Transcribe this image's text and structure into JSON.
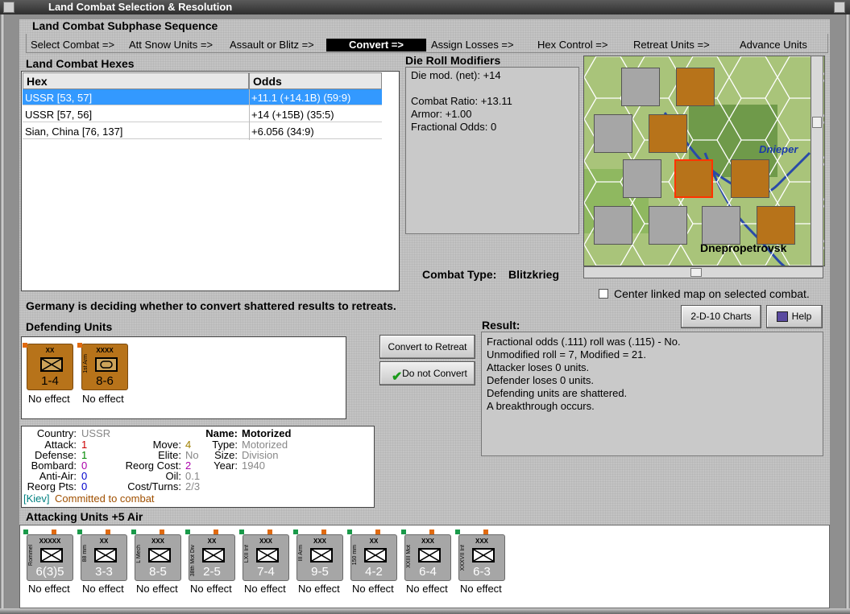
{
  "window": {
    "title": "Land Combat Selection & Resolution"
  },
  "sequence": {
    "title": "Land Combat Subphase Sequence",
    "steps": [
      {
        "label": "Select Combat =>"
      },
      {
        "label": "Att Snow Units =>"
      },
      {
        "label": "Assault or Blitz =>"
      },
      {
        "label": "Convert =>"
      },
      {
        "label": "Assign Losses =>"
      },
      {
        "label": "Hex Control =>"
      },
      {
        "label": "Retreat Units =>"
      },
      {
        "label": "Advance Units"
      }
    ],
    "active_index": 3
  },
  "hexes": {
    "title": "Land Combat Hexes",
    "columns": [
      "Hex",
      "Odds"
    ],
    "rows": [
      {
        "hex": "USSR [53, 57]",
        "odds": "+11.1 (+14.1B) (59:9)",
        "selected": true
      },
      {
        "hex": "USSR [57, 56]",
        "odds": "+14 (+15B) (35:5)",
        "selected": false
      },
      {
        "hex": "Sian, China [76, 137]",
        "odds": "+6.056 (34:9)",
        "selected": false
      }
    ]
  },
  "modifiers": {
    "title": "Die Roll Modifiers",
    "lines": [
      "Die mod. (net): +14",
      "",
      "Combat Ratio: +13.11",
      "Armor: +1.00",
      "Fractional Odds: 0"
    ]
  },
  "combat_type": {
    "label": "Combat Type:",
    "value": "Blitzkrieg"
  },
  "map": {
    "river_label": "Dnieper",
    "city_label": "Dnepropetrovsk",
    "center_checkbox_label": "Center linked map on selected combat.",
    "center_checked": false
  },
  "status_message": "Germany is deciding whether to convert shattered results to retreats.",
  "buttons": {
    "convert": "Convert to Retreat",
    "do_not_convert": "Do not Convert",
    "charts": "2-D-10 Charts",
    "help": "Help"
  },
  "defenders": {
    "title": "Defending Units",
    "units": [
      {
        "size": "XX",
        "value": "1-4",
        "effect": "No effect",
        "side": ""
      },
      {
        "size": "XXXX",
        "value": "8-6",
        "effect": "No effect",
        "side": "1st Arm"
      }
    ]
  },
  "result": {
    "title": "Result:",
    "lines": [
      "Fractional odds (.111) roll was (.115)  - No.",
      "Unmodified roll = 7, Modified = 21.",
      "Attacker loses 0 units.",
      "Defender loses 0 units.",
      "Defending units are shattered.",
      "A breakthrough occurs."
    ]
  },
  "unit_info": {
    "country_label": "Country:",
    "country": "USSR",
    "attack_label": "Attack:",
    "attack": "1",
    "defense_label": "Defense:",
    "defense": "1",
    "bombard_label": "Bombard:",
    "bombard": "0",
    "antiair_label": "Anti-Air:",
    "antiair": "0",
    "reorg_label": "Reorg Pts:",
    "reorg": "0",
    "move_label": "Move:",
    "move": "4",
    "elite_label": "Elite:",
    "elite": "No",
    "reorg_cost_label": "Reorg Cost:",
    "reorg_cost": "2",
    "oil_label": "Oil:",
    "oil": "0.1",
    "cost_label": "Cost/Turns:",
    "cost": "2/3",
    "name_label": "Name:",
    "name": "Motorized",
    "type_label": "Type:",
    "type": "Motorized",
    "size_label": "Size:",
    "size": "Division",
    "year_label": "Year:",
    "year": "1940",
    "location": "[Kiev]",
    "status": "Committed to combat"
  },
  "attackers": {
    "title": "Attacking Units +5 Air",
    "units": [
      {
        "size": "XXXXX",
        "value": "6(3)5",
        "side": "Rommel",
        "effect": "No effect"
      },
      {
        "size": "XX",
        "value": "3-3",
        "side": "88 mm",
        "effect": "No effect"
      },
      {
        "size": "XXX",
        "value": "8-5",
        "side": "L Mech",
        "effect": "No effect"
      },
      {
        "size": "XX",
        "value": "2-5",
        "side": "38th Mot Div",
        "effect": "No effect"
      },
      {
        "size": "XXX",
        "value": "7-4",
        "side": "LXII Inf",
        "effect": "No effect"
      },
      {
        "size": "XXX",
        "value": "9-5",
        "side": "III Arm",
        "effect": "No effect"
      },
      {
        "size": "XX",
        "value": "4-2",
        "side": "150 mm",
        "effect": "No effect"
      },
      {
        "size": "XXX",
        "value": "6-4",
        "side": "XXIII Mot",
        "effect": "No effect"
      },
      {
        "size": "XXX",
        "value": "6-3",
        "side": "XXXVII Inf",
        "effect": "No effect"
      }
    ]
  },
  "colors": {
    "selection": "#3399ff",
    "german_counter": "#a6a6a6",
    "soviet_counter": "#b7731a",
    "attack": "#cc0000",
    "defense": "#008800",
    "bombard": "#aa00aa",
    "antiair": "#0000cc",
    "move": "#a08000",
    "status_text": "#a05000",
    "location_text": "#008080"
  }
}
